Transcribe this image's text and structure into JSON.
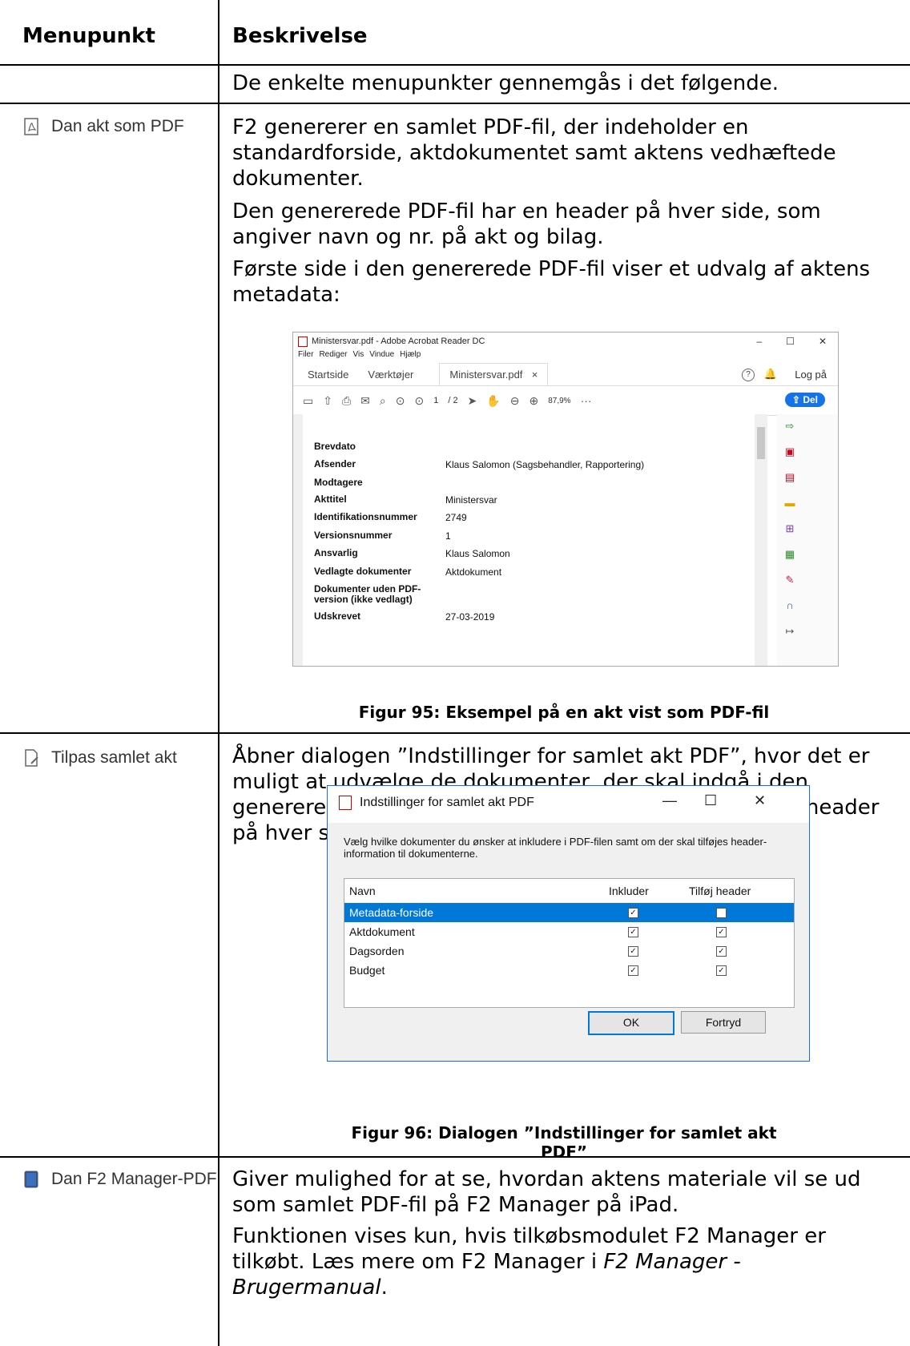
{
  "table": {
    "col1_header": "Menupunkt",
    "col2_header": "Beskrivelse",
    "intro_text": "De enkelte menupunkter gennemgås i følgende.",
    "rows": [
      {
        "menu_label": "Dan akt som PDF",
        "paragraphs": [
          "F2 genererer en samlet PDF-fil, der indeholder en standardforside, aktdokumentet samt aktens vedhæftede dokumenter.",
          "Den genererede PDF-fil har en header på hver side, som angiver navn og nr. på akt og bilag.",
          "Første side i den genererede PDF-fil viser et udvalg af aktens metadata:"
        ],
        "caption": "Figur 95: Eksempel på en akt vist som PDF-fil"
      },
      {
        "menu_label": "Tilpas samlet akt",
        "paragraphs": [
          "Åbner dialogen ”Indstillinger for samlet akt PDF”, hvor det er muligt at udvælge de dokumenter, der skal indgå i den genererede PDF-fil, og om der skal være en dokument-header på hver side."
        ],
        "caption": "Figur 96: Dialogen ”Indstillinger for samlet akt PDF”"
      },
      {
        "menu_label": "Dan F2 Manager-PDF",
        "paragraphs": [
          "Giver mulighed for at se, hvordan aktens materiale vil se ud som samlet PDF-fil på F2 Manager på iPad.",
          "Funktionen vises kun, hvis tilkøbsmodulet F2 Manager er tilkøbt. Læs mere om F2 Manager i ",
          "F2 Manager - Brugermanual",
          "."
        ]
      }
    ]
  },
  "acrobat": {
    "window_title": "Ministersvar.pdf - Adobe Acrobat Reader DC",
    "menus": [
      "Filer",
      "Rediger",
      "Vis",
      "Vindue",
      "Hjælp"
    ],
    "tabs": [
      "Startside",
      "Værktøjer",
      "Ministersvar.pdf"
    ],
    "tab_close": "×",
    "help": "?",
    "login": "Log på",
    "page_current": "1",
    "page_total": "/ 2",
    "zoom": "87,9%",
    "more": "···",
    "share_button": "Del",
    "metadata": [
      {
        "key": "Brevdato",
        "value": ""
      },
      {
        "key": "Afsender",
        "value": "Klaus Salomon (Sagsbehandler, Rapportering)"
      },
      {
        "key": "Modtagere",
        "value": ""
      },
      {
        "key": "Akttitel",
        "value": "Ministersvar"
      },
      {
        "key": "Identifikationsnummer",
        "value": "2749"
      },
      {
        "key": "Versionsnummer",
        "value": "1"
      },
      {
        "key": "Ansvarlig",
        "value": "Klaus Salomon"
      },
      {
        "key": "Vedlagte dokumenter",
        "value": "Aktdokument"
      },
      {
        "key": "Dokumenter uden PDF-version (ikke vedlagt)",
        "value": ""
      },
      {
        "key": "Udskrevet",
        "value": "27-03-2019"
      }
    ]
  },
  "dialog": {
    "title": "Indstillinger for samlet akt PDF",
    "description": "Vælg hvilke dokumenter du ønsker at inkludere i PDF-filen samt om der skal tilføjes header-information til dokumenterne.",
    "columns": [
      "Navn",
      "Inkluder",
      "Tilføj header"
    ],
    "rows": [
      {
        "name": "Metadata-forside",
        "include": true,
        "header": false,
        "selected": true
      },
      {
        "name": "Aktdokument",
        "include": true,
        "header": true,
        "selected": false
      },
      {
        "name": "Dagsorden",
        "include": true,
        "header": true,
        "selected": false
      },
      {
        "name": "Budget",
        "include": true,
        "header": true,
        "selected": false
      }
    ],
    "ok_label": "OK",
    "cancel_label": "Fortryd"
  },
  "colors": {
    "accent": "#0078d7",
    "acrobat_blue": "#1473e6",
    "pdf_red": "#cc0000"
  }
}
